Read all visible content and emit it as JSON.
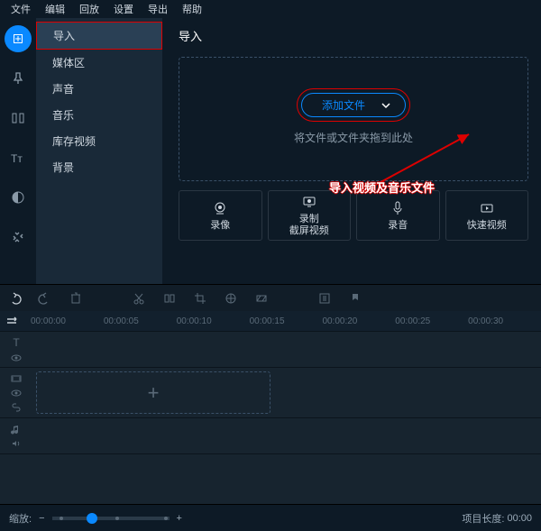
{
  "menubar": [
    "文件",
    "编辑",
    "回放",
    "设置",
    "导出",
    "帮助"
  ],
  "side_panel": {
    "items": [
      "导入",
      "媒体区",
      "声音",
      "音乐",
      "库存视频",
      "背景"
    ],
    "selected": 0
  },
  "content": {
    "title": "导入",
    "add_button": "添加文件",
    "drop_hint": "将文件或文件夹拖到此处",
    "annotation": "导入视频及音乐文件"
  },
  "record_cards": [
    {
      "label": "录像",
      "icon": "webcam"
    },
    {
      "label": "录制\n截屏视频",
      "icon": "screen"
    },
    {
      "label": "录音",
      "icon": "mic"
    },
    {
      "label": "快速视频",
      "icon": "quick"
    }
  ],
  "timeline": {
    "ticks": [
      "00:00:00",
      "00:00:05",
      "00:00:10",
      "00:00:15",
      "00:00:20",
      "00:00:25",
      "00:00:30"
    ]
  },
  "footer": {
    "zoom_label": "缩放:",
    "project_len_label": "项目长度:",
    "project_len": "00:00"
  }
}
